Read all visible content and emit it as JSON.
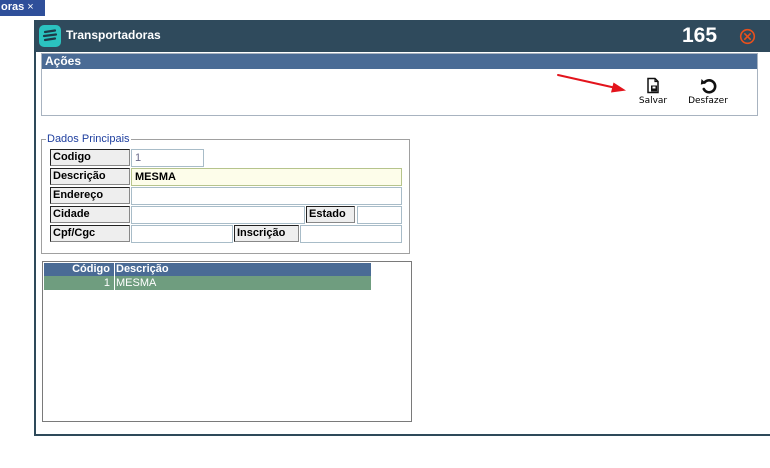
{
  "top_tab": {
    "label": "oras",
    "close": "×"
  },
  "window": {
    "title": "Transportadoras",
    "count": "165"
  },
  "acoes": {
    "header": "Ações",
    "buttons": [
      {
        "label": "Salvar",
        "icon": "save-document-icon"
      },
      {
        "label": "Desfazer",
        "icon": "undo-icon"
      }
    ]
  },
  "dados": {
    "legend": "Dados Principais",
    "codigo_label": "Codigo",
    "codigo_value": "1",
    "descricao_label": "Descrição",
    "descricao_value": "MESMA",
    "endereco_label": "Endereço",
    "endereco_value": "",
    "cidade_label": "Cidade",
    "cidade_value": "",
    "estado_label": "Estado",
    "estado_value": "",
    "cpf_label": "Cpf/Cgc",
    "cpf_value": "",
    "inscricao_label": "Inscrição",
    "inscricao_value": ""
  },
  "grid": {
    "columns": [
      "Código",
      "Descrição"
    ],
    "rows": [
      {
        "codigo": "1",
        "descricao": "MESMA"
      }
    ]
  },
  "colors": {
    "titlebar": "#2f4a5c",
    "section_header": "#4a6b95",
    "selected_row": "#6f9d7f",
    "icon_teal": "#2bc3c0",
    "close_orange": "#e8501c",
    "annotation_red": "#e3141c"
  }
}
